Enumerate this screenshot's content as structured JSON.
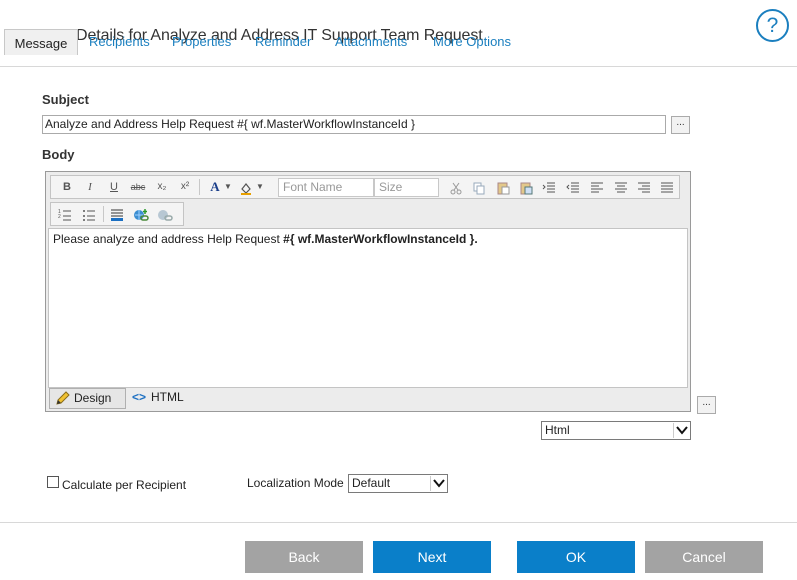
{
  "dialog": {
    "title": "Details for Analyze and Address IT Support Team Request",
    "help": "?"
  },
  "tabs": [
    "Message",
    "Recipients",
    "Properties",
    "Reminder",
    "Attachments",
    "More Options"
  ],
  "subject": {
    "label": "Subject",
    "value": "Analyze and Address Help Request #{ wf.MasterWorkflowInstanceId }",
    "browse": "..."
  },
  "body": {
    "label": "Body",
    "toolbar": {
      "bold": "B",
      "italic": "I",
      "underline": "U",
      "strike": "abc",
      "subscript": "x₂",
      "superscript": "x²",
      "font_color": "A",
      "font_name_placeholder": "Font Name",
      "size_placeholder": "Size"
    },
    "content_plain": "Please analyze and address Help Request ",
    "content_bold": "#{ wf.MasterWorkflowInstanceId }.",
    "mode_design": "Design",
    "mode_html": "HTML",
    "browse": "...",
    "format_select": "Html"
  },
  "options": {
    "calculate_per_recipient": "Calculate per Recipient",
    "localization_label": "Localization Mode",
    "localization_value": "Default"
  },
  "buttons": {
    "back": "Back",
    "next": "Next",
    "ok": "OK",
    "cancel": "Cancel"
  },
  "colors": {
    "accent": "#0a7fc9",
    "link": "#1b7fbf",
    "disabled": "#a3a3a3"
  }
}
